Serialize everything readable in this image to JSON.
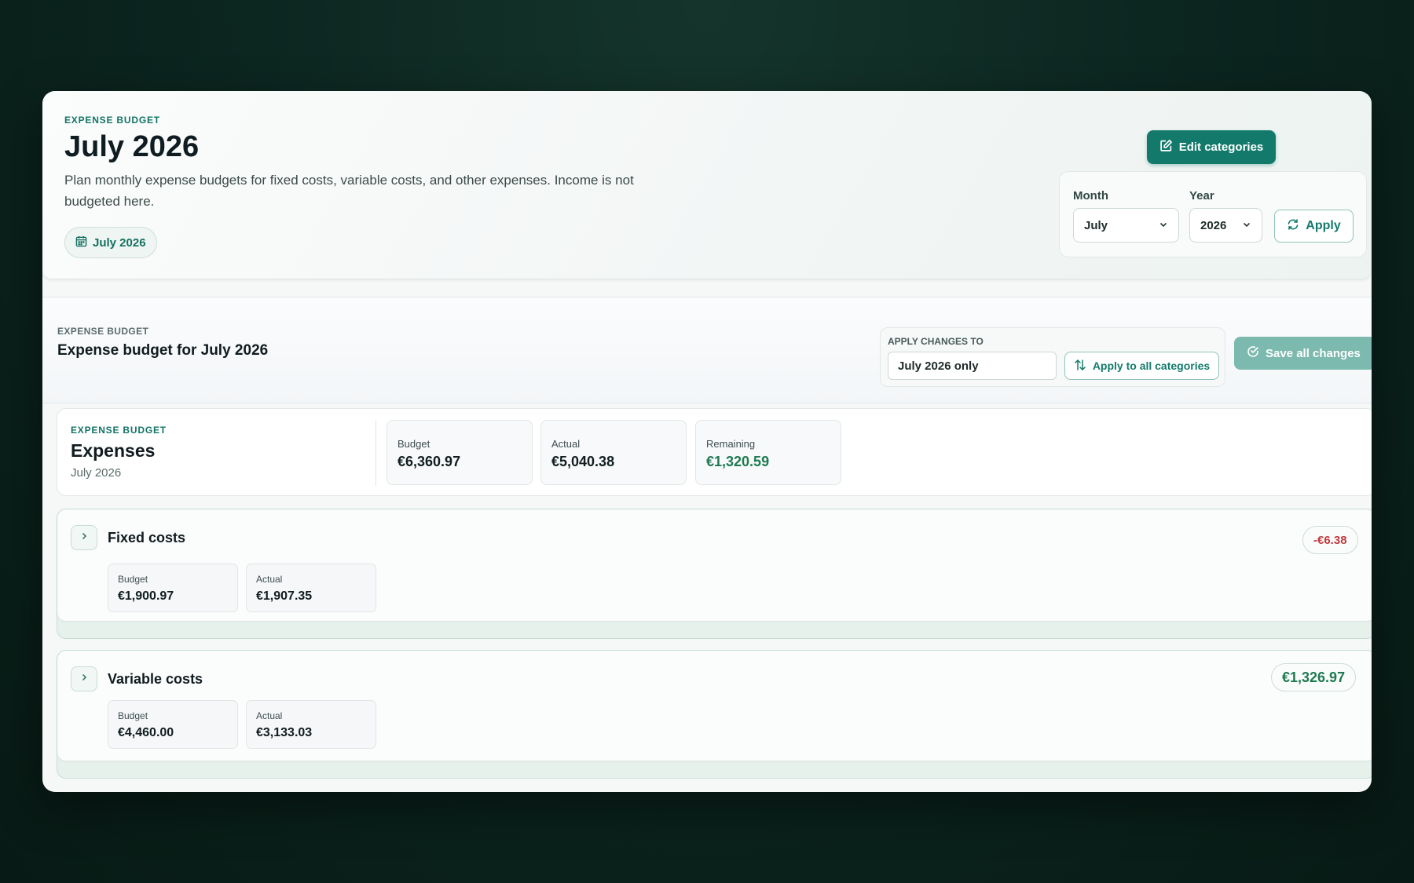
{
  "header": {
    "eyebrow": "EXPENSE BUDGET",
    "title": "July 2026",
    "description": "Plan monthly expense budgets for fixed costs, variable costs, and other expenses. Income is not budgeted here.",
    "period_pill": "July 2026",
    "edit_button": "Edit categories",
    "month_label": "Month",
    "month_value": "July",
    "year_label": "Year",
    "year_value": "2026",
    "apply_button": "Apply"
  },
  "toolbar": {
    "eyebrow": "EXPENSE BUDGET",
    "title": "Expense budget for July 2026",
    "apply_changes_label": "APPLY CHANGES TO",
    "scope_value": "July 2026 only",
    "apply_all_button": "Apply to all categories",
    "save_button": "Save all changes"
  },
  "summary": {
    "eyebrow": "EXPENSE BUDGET",
    "title": "Expenses",
    "period": "July 2026",
    "budget_label": "Budget",
    "budget_value": "€6,360.97",
    "actual_label": "Actual",
    "actual_value": "€5,040.38",
    "remaining_label": "Remaining",
    "remaining_value": "€1,320.59"
  },
  "categories": [
    {
      "name": "Fixed costs",
      "budget_label": "Budget",
      "budget_value": "€1,900.97",
      "actual_label": "Actual",
      "actual_value": "€1,907.35",
      "difference": "-€6.38"
    },
    {
      "name": "Variable costs",
      "budget_label": "Budget",
      "budget_value": "€4,460.00",
      "actual_label": "Actual",
      "actual_value": "€3,133.03",
      "difference": "€1,326.97"
    }
  ],
  "icons": {
    "calendar": "calendar-icon",
    "edit": "edit-icon",
    "chevron_down": "chevron-down-icon",
    "refresh": "refresh-icon",
    "swap": "swap-vertical-icon",
    "check": "check-circle-icon",
    "chevron_right": "chevron-right-icon"
  },
  "colors": {
    "accent": "#137a6b",
    "positive": "#1e7a52",
    "negative": "#c23a3f",
    "background": "#0c2620"
  }
}
